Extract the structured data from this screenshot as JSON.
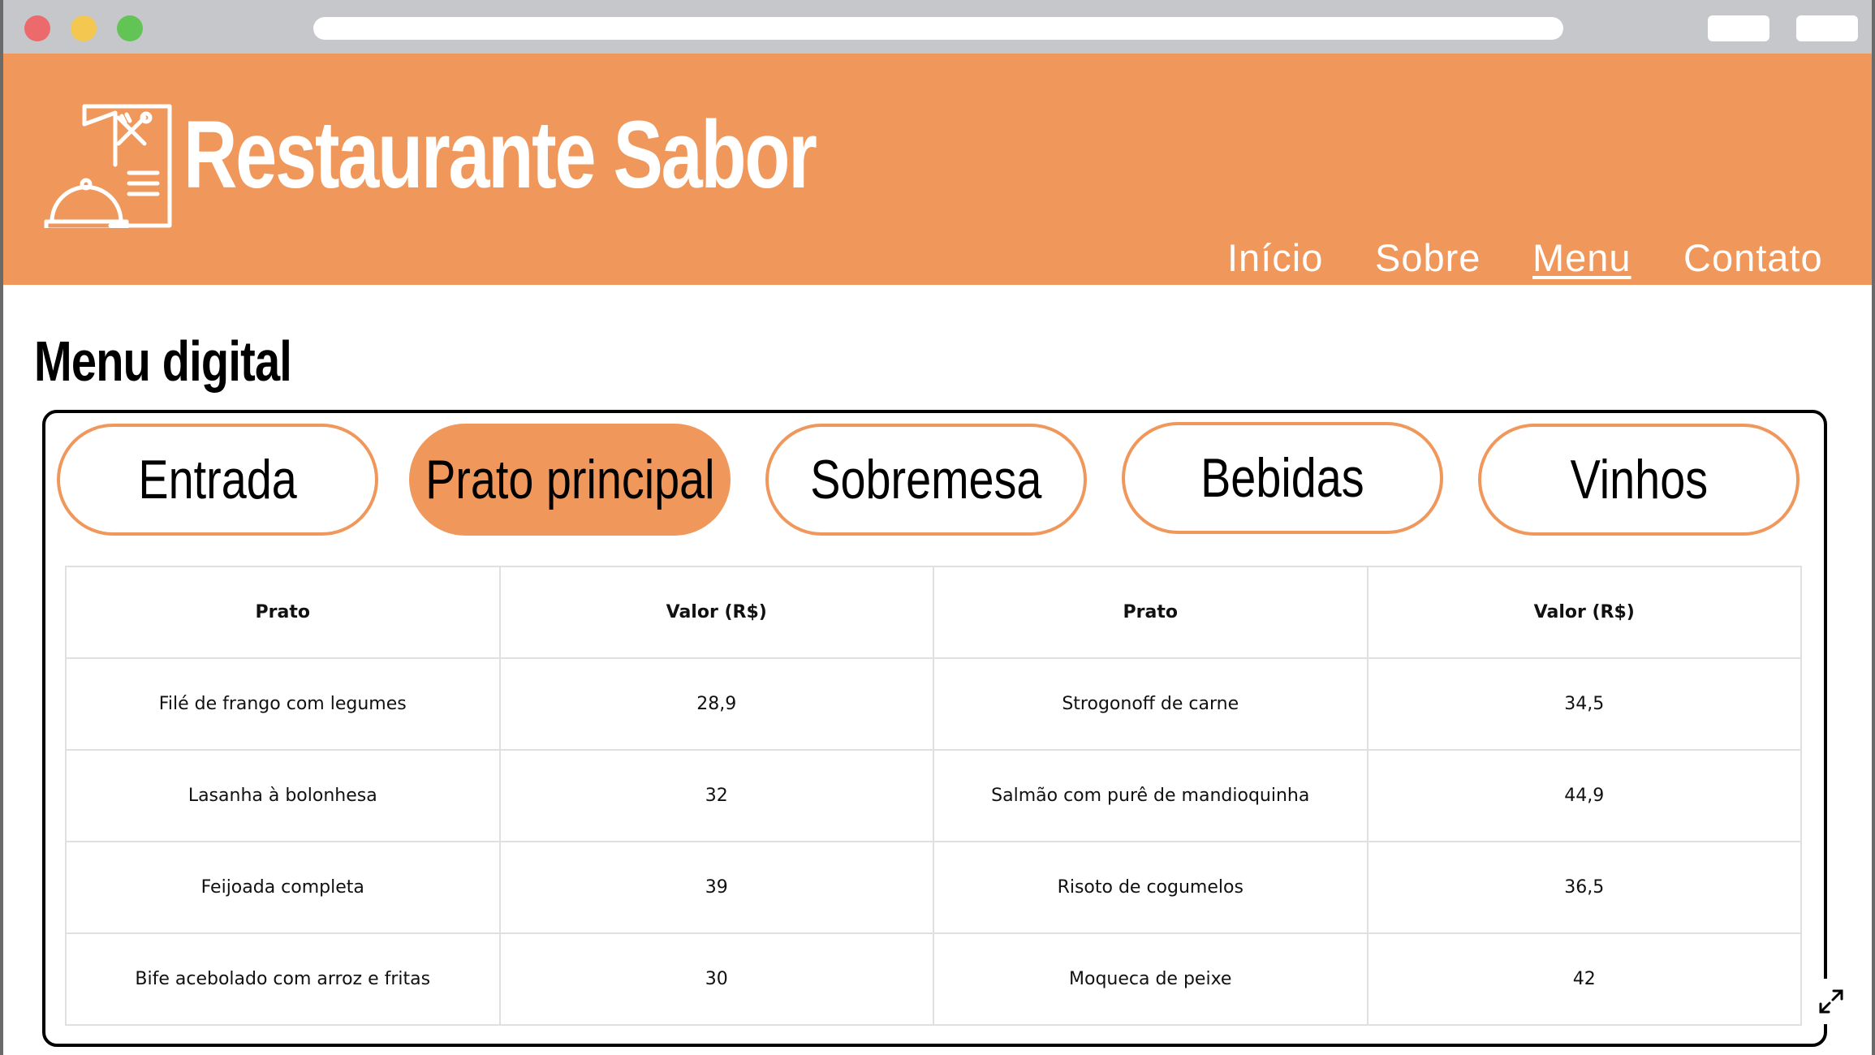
{
  "browser": {
    "controls": [
      "close",
      "minimize",
      "zoom"
    ]
  },
  "header": {
    "brand": "Restaurante Sabor",
    "logo_icon": "menu-cloche-icon",
    "nav": [
      {
        "label": "Início",
        "active": false
      },
      {
        "label": "Sobre",
        "active": false
      },
      {
        "label": "Menu",
        "active": true
      },
      {
        "label": "Contato",
        "active": false
      }
    ]
  },
  "main": {
    "title": "Menu digital",
    "tabs": [
      {
        "label": "Entrada",
        "active": false
      },
      {
        "label": "Prato principal",
        "active": true
      },
      {
        "label": "Sobremesa",
        "active": false
      },
      {
        "label": "Bebidas",
        "active": false
      },
      {
        "label": "Vinhos",
        "active": false
      }
    ],
    "table": {
      "headers": [
        "Prato",
        "Valor (R$)",
        "Prato",
        "Valor (R$)"
      ],
      "rows": [
        [
          "Filé de frango com legumes",
          "28,9",
          "Strogonoff de carne",
          "34,5"
        ],
        [
          "Lasanha à bolonhesa",
          "32",
          "Salmão com purê de mandioquinha",
          "44,9"
        ],
        [
          "Feijoada completa",
          "39",
          "Risoto de cogumelos",
          "36,5"
        ],
        [
          "Bife acebolado com arroz e fritas",
          "30",
          "Moqueca de peixe",
          "42"
        ]
      ]
    },
    "expand_icon": "expand-icon"
  },
  "colors": {
    "accent": "#f0975b",
    "chrome": "#c6c7ca"
  }
}
